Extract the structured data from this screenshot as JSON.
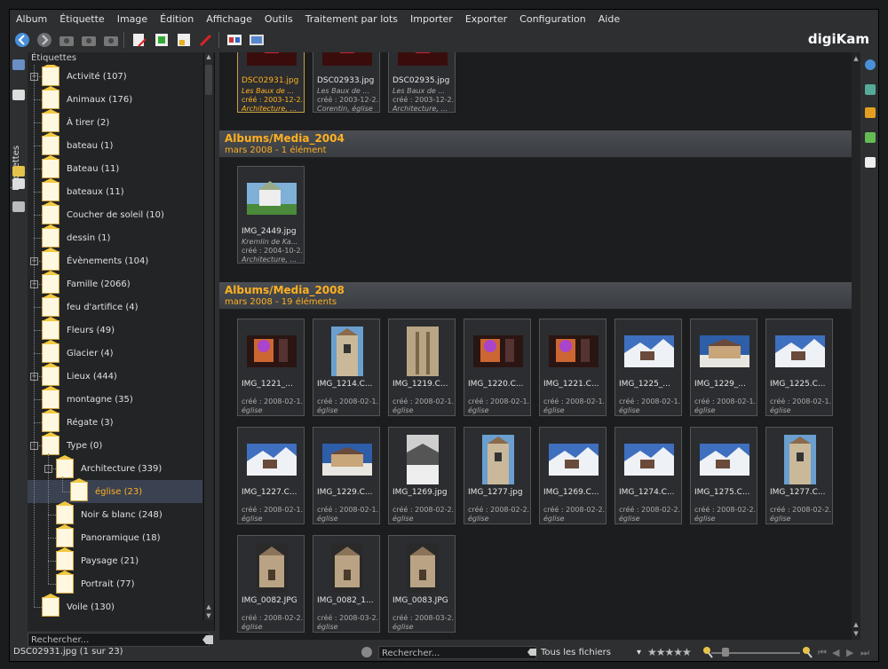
{
  "menu": [
    "Album",
    "Étiquette",
    "Image",
    "Édition",
    "Affichage",
    "Outils",
    "Traitement par lots",
    "Importer",
    "Exporter",
    "Configuration",
    "Aide"
  ],
  "brand": "digiKam",
  "left_panel": {
    "title": "Étiquettes",
    "vertical_tab": "Étiquettes",
    "search_placeholder": "Rechercher...",
    "tags": [
      {
        "label": "Activité (107)",
        "level": 0,
        "expander": "+"
      },
      {
        "label": "Animaux (176)",
        "level": 0,
        "expander": ""
      },
      {
        "label": "À tirer (2)",
        "level": 0,
        "expander": ""
      },
      {
        "label": "bateau (1)",
        "level": 0,
        "expander": ""
      },
      {
        "label": "Bateau (11)",
        "level": 0,
        "expander": ""
      },
      {
        "label": "bateaux (11)",
        "level": 0,
        "expander": ""
      },
      {
        "label": "Coucher de soleil (10)",
        "level": 0,
        "expander": ""
      },
      {
        "label": "dessin (1)",
        "level": 0,
        "expander": ""
      },
      {
        "label": "Évènements (104)",
        "level": 0,
        "expander": "+"
      },
      {
        "label": "Famille (2066)",
        "level": 0,
        "expander": "+"
      },
      {
        "label": "feu d'artifice (4)",
        "level": 0,
        "expander": ""
      },
      {
        "label": "Fleurs (49)",
        "level": 0,
        "expander": ""
      },
      {
        "label": "Glacier (4)",
        "level": 0,
        "expander": ""
      },
      {
        "label": "Lieux (444)",
        "level": 0,
        "expander": "+"
      },
      {
        "label": "montagne (35)",
        "level": 0,
        "expander": ""
      },
      {
        "label": "Régate (3)",
        "level": 0,
        "expander": ""
      },
      {
        "label": "Type (0)",
        "level": 0,
        "expander": "-"
      },
      {
        "label": "Architecture (339)",
        "level": 1,
        "expander": "-"
      },
      {
        "label": "église (23)",
        "level": 2,
        "expander": "",
        "selected": true
      },
      {
        "label": "Noir & blanc (248)",
        "level": 1,
        "expander": ""
      },
      {
        "label": "Panoramique (18)",
        "level": 1,
        "expander": ""
      },
      {
        "label": "Paysage (21)",
        "level": 1,
        "expander": ""
      },
      {
        "label": "Portrait (77)",
        "level": 1,
        "expander": ""
      },
      {
        "label": "Voile (130)",
        "level": 0,
        "expander": ""
      }
    ]
  },
  "top_row": [
    {
      "name": "DSC02931.jpg",
      "l1": "Les Baux de ...",
      "l2": "créé : 2003-12-2...",
      "l3": "Architecture, ...",
      "current": true,
      "palette": "red"
    },
    {
      "name": "DSC02933.jpg",
      "l1": "Les Baux de ...",
      "l2": "créé : 2003-12-2...",
      "l3": "Corentin, église",
      "current": false,
      "palette": "red"
    },
    {
      "name": "DSC02935.jpg",
      "l1": "Les Baux de ...",
      "l2": "créé : 2003-12-2...",
      "l3": "Architecture, ...",
      "current": false,
      "palette": "red"
    }
  ],
  "groups": [
    {
      "title": "Albums/Media_2004",
      "subtitle": "mars 2008 - 1 élément",
      "items": [
        {
          "name": "IMG_2449.jpg",
          "l1": "Kremlin de Ka...",
          "l2": "créé : 2004-10-2...",
          "l3": "Architecture, ...",
          "palette": "green"
        }
      ]
    },
    {
      "title": "Albums/Media_2008",
      "subtitle": "mars 2008 - 19 éléments",
      "items": [
        {
          "name": "IMG_1221_...",
          "l2": "créé : 2008-02-1...",
          "l3": "église",
          "palette": "stained"
        },
        {
          "name": "IMG_1214.C...",
          "l2": "créé : 2008-02-1...",
          "l3": "église",
          "palette": "tower"
        },
        {
          "name": "IMG_1219.C...",
          "l2": "créé : 2008-02-1...",
          "l3": "église",
          "palette": "stone"
        },
        {
          "name": "IMG_1220.C...",
          "l2": "créé : 2008-02-1...",
          "l3": "église",
          "palette": "stained"
        },
        {
          "name": "IMG_1221.C...",
          "l2": "créé : 2008-02-1...",
          "l3": "église",
          "palette": "stained"
        },
        {
          "name": "IMG_1225_...",
          "l2": "créé : 2008-02-1...",
          "l3": "église",
          "palette": "snow"
        },
        {
          "name": "IMG_1229_...",
          "l2": "créé : 2008-02-1...",
          "l3": "église",
          "palette": "church"
        },
        {
          "name": "IMG_1225.C...",
          "l2": "créé : 2008-02-1...",
          "l3": "église",
          "palette": "snow"
        },
        {
          "name": "IMG_1227.C...",
          "l2": "créé : 2008-02-1...",
          "l3": "église",
          "palette": "snow"
        },
        {
          "name": "IMG_1229.C...",
          "l2": "créé : 2008-02-1...",
          "l3": "église",
          "palette": "church"
        },
        {
          "name": "IMG_1269.jpg",
          "l2": "créé : 2008-02-2...",
          "l3": "église",
          "palette": "bw"
        },
        {
          "name": "IMG_1277.jpg",
          "l2": "créé : 2008-02-2...",
          "l3": "église",
          "palette": "tower"
        },
        {
          "name": "IMG_1269.C...",
          "l2": "créé : 2008-02-2...",
          "l3": "église",
          "palette": "snow"
        },
        {
          "name": "IMG_1274.C...",
          "l2": "créé : 2008-02-2...",
          "l3": "église",
          "palette": "snow"
        },
        {
          "name": "IMG_1275.C...",
          "l2": "créé : 2008-02-2...",
          "l3": "église",
          "palette": "snow"
        },
        {
          "name": "IMG_1277.C...",
          "l2": "créé : 2008-02-2...",
          "l3": "église",
          "palette": "tower"
        },
        {
          "name": "IMG_0082.JPG",
          "l2": "créé : 2008-02-2...",
          "l3": "église",
          "palette": "cathedral"
        },
        {
          "name": "IMG_0082_1...",
          "l2": "créé : 2008-03-2...",
          "l3": "église",
          "palette": "cathedral"
        },
        {
          "name": "IMG_0083.JPG",
          "l2": "créé : 2008-03-2...",
          "l3": "église",
          "palette": "cathedral"
        }
      ]
    }
  ],
  "status": {
    "text": "DSC02931.jpg (1 sur 23)",
    "search_placeholder": "Rechercher...",
    "filter": "Tous les fichiers",
    "rating": "★★★★★"
  }
}
